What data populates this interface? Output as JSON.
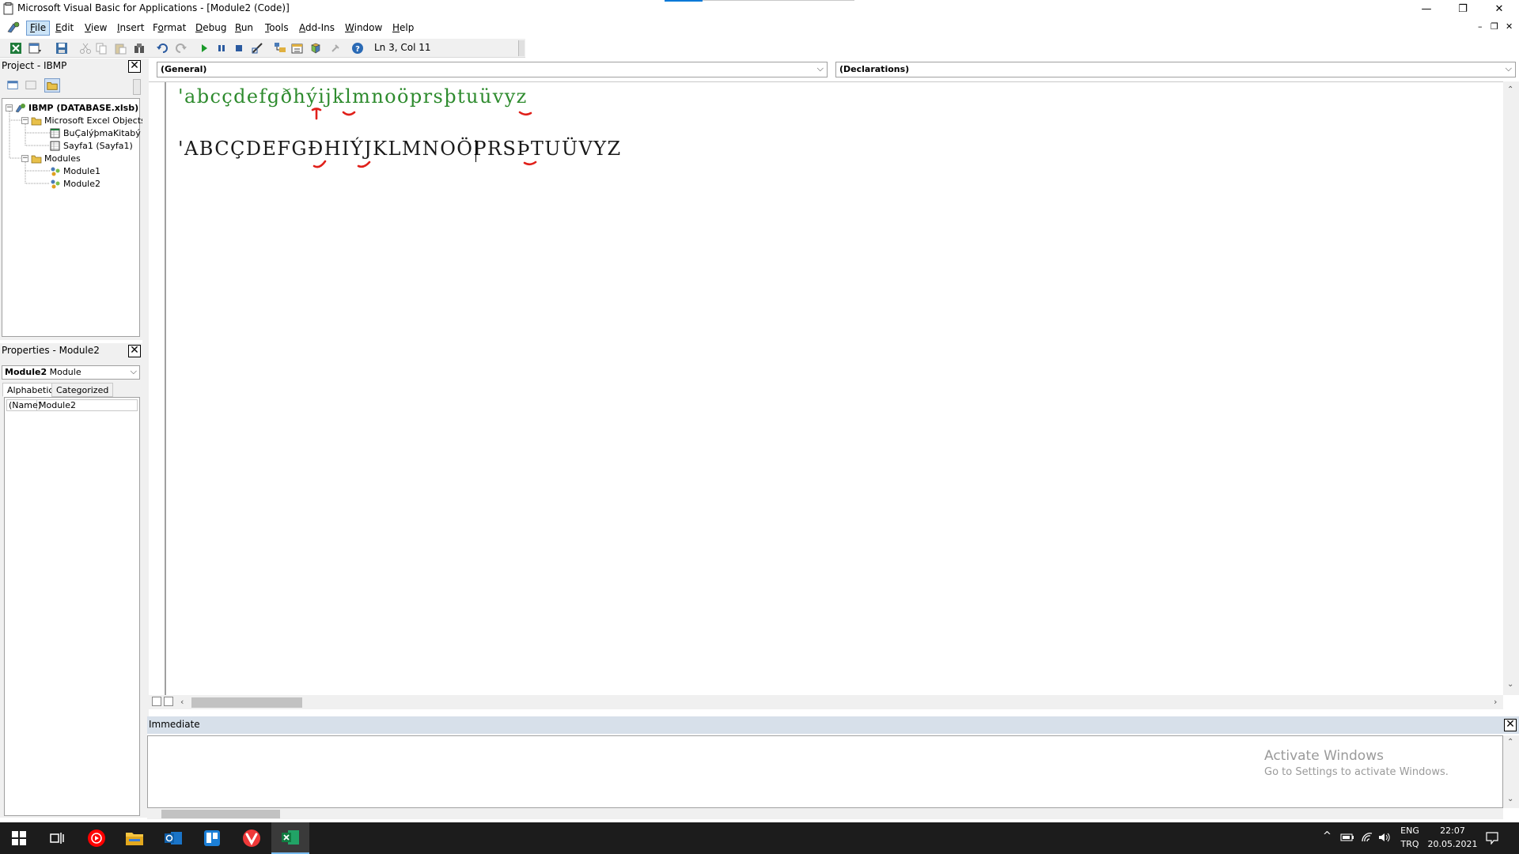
{
  "window": {
    "title": "Microsoft Visual Basic for Applications - [Module2 (Code)]",
    "minimize_glyph": "—",
    "restore_glyph": "❐",
    "close_glyph": "✕"
  },
  "menu": {
    "items": [
      {
        "label": "File",
        "accel": "F",
        "rest": "ile"
      },
      {
        "label": "Edit",
        "accel": "E",
        "rest": "dit"
      },
      {
        "label": "View",
        "accel": "V",
        "rest": "iew"
      },
      {
        "label": "Insert",
        "accel": "I",
        "rest": "nsert"
      },
      {
        "label": "Format",
        "accel": "o",
        "pre": "F",
        "rest": "rmat"
      },
      {
        "label": "Debug",
        "accel": "D",
        "rest": "ebug"
      },
      {
        "label": "Run",
        "accel": "R",
        "rest": "un"
      },
      {
        "label": "Tools",
        "accel": "T",
        "rest": "ools"
      },
      {
        "label": "Add-Ins",
        "accel": "A",
        "rest": "dd-Ins"
      },
      {
        "label": "Window",
        "accel": "W",
        "rest": "indow"
      },
      {
        "label": "Help",
        "accel": "H",
        "rest": "elp"
      }
    ],
    "mdi_min": "–",
    "mdi_restore": "❐",
    "mdi_close": "✕"
  },
  "toolbar": {
    "position": "Ln 3, Col 11",
    "icons": [
      "excel-view-icon",
      "insert-module-icon",
      "save-icon",
      "cut-icon",
      "copy-icon",
      "paste-icon",
      "find-icon",
      "undo-icon",
      "redo-icon",
      "run-icon",
      "break-icon",
      "reset-icon",
      "design-mode-icon",
      "project-explorer-icon",
      "properties-icon",
      "object-browser-icon",
      "toolbox-icon",
      "help-icon"
    ]
  },
  "project_panel": {
    "title": "Project - IBMP",
    "close": "✕",
    "tree": {
      "root": "IBMP (DATABASE.xlsb)",
      "excel_objects": "Microsoft Excel Objects",
      "workbook": "BuÇalýþmaKitabý",
      "sheet": "Sayfa1 (Sayfa1)",
      "modules": "Modules",
      "module1": "Module1",
      "module2": "Module2"
    }
  },
  "properties_panel": {
    "title": "Properties - Module2",
    "close": "✕",
    "object_name": "Module2",
    "object_type": "Module",
    "tab_alpha": "Alphabetic",
    "tab_categorized": "Categorized",
    "prop_key": "(Name)",
    "prop_value": "Module2"
  },
  "code": {
    "object_combo": "(General)",
    "proc_combo": "(Declarations)",
    "line1": "'abcçdefgðhýijklmnoöprsþtuüvyz",
    "line3": "'ABCÇDEFGÐHIÝJKLMNOÖPRSÞTUÜVYZ",
    "annotation_color": "#e0201a",
    "comment_color": "#2e8b2e"
  },
  "immediate": {
    "title": "Immediate",
    "close": "✕"
  },
  "watermark": {
    "line1": "Activate Windows",
    "line2": "Go to Settings to activate Windows."
  },
  "taskbar": {
    "apps": [
      "windows-start-icon",
      "task-view-icon",
      "youtube-music-icon",
      "file-explorer-icon",
      "outlook-icon",
      "trello-icon",
      "vivaldi-icon",
      "excel-icon"
    ],
    "lang_top": "ENG",
    "lang_bottom": "TRQ",
    "time": "22:07",
    "date": "20.05.2021"
  }
}
